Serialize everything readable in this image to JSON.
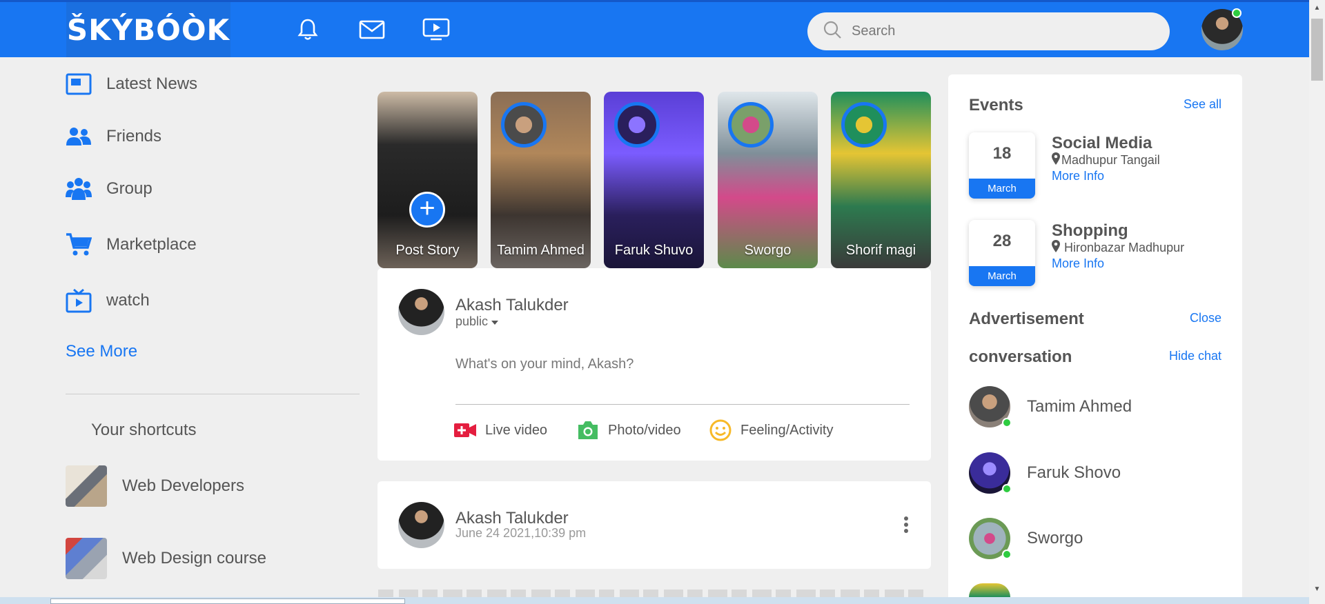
{
  "app": {
    "logo": "ŠKÝBÓÒK",
    "search_placeholder": "Search"
  },
  "nav_icons": [
    "bell-icon",
    "mail-icon",
    "video-icon"
  ],
  "colors": {
    "brand": "#1876f2",
    "online": "#2ecc40",
    "live": "#e41e3f",
    "photo": "#45bd62",
    "feeling": "#f7b928"
  },
  "sidebar": {
    "items": [
      {
        "label": "Latest News",
        "icon": "news-icon"
      },
      {
        "label": "Friends",
        "icon": "friends-icon"
      },
      {
        "label": "Group",
        "icon": "group-icon"
      },
      {
        "label": "Marketplace",
        "icon": "cart-icon"
      },
      {
        "label": "watch",
        "icon": "watch-icon"
      }
    ],
    "see_more": "See More",
    "shortcuts_title": "Your shortcuts",
    "shortcuts": [
      {
        "label": "Web Developers"
      },
      {
        "label": "Web Design course"
      }
    ]
  },
  "stories": [
    {
      "name": "Post Story"
    },
    {
      "name": "Tamim Ahmed"
    },
    {
      "name": "Faruk Shuvo"
    },
    {
      "name": "Sworgo"
    },
    {
      "name": "Shorif magi"
    }
  ],
  "composer": {
    "user_name": "Akash Talukder",
    "privacy": "public",
    "placeholder": "What's on your mind, Akash?",
    "actions": [
      {
        "label": "Live video",
        "icon": "live-video-icon"
      },
      {
        "label": "Photo/video",
        "icon": "camera-icon"
      },
      {
        "label": "Feeling/Activity",
        "icon": "smiley-icon"
      }
    ]
  },
  "post": {
    "user_name": "Akash Talukder",
    "timestamp": "June 24 2021,10:39 pm"
  },
  "right": {
    "events_title": "Events",
    "see_all": "See all",
    "events": [
      {
        "day": "18",
        "month": "March",
        "title": "Social Media",
        "location": "Madhupur Tangail",
        "more": "More Info"
      },
      {
        "day": "28",
        "month": "March",
        "title": "Shopping",
        "location": "Hironbazar Madhupur",
        "more": "More Info"
      }
    ],
    "ad_title": "Advertisement",
    "ad_close": "Close",
    "conversation_title": "conversation",
    "hide_chat": "Hide chat",
    "conversations": [
      {
        "name": "Tamim Ahmed"
      },
      {
        "name": "Faruk Shovo"
      },
      {
        "name": "Sworgo"
      }
    ]
  }
}
